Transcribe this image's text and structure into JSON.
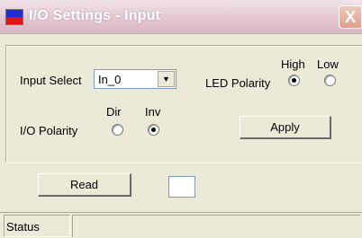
{
  "window": {
    "title": "I/O Settings - Input",
    "close_glyph": "X",
    "icon": "app-icon"
  },
  "input_select": {
    "label": "Input Select",
    "value": "In_0",
    "arrow_glyph": "▼"
  },
  "led_polarity": {
    "label": "LED Polarity",
    "options": [
      {
        "label": "High",
        "selected": true
      },
      {
        "label": "Low",
        "selected": false
      }
    ]
  },
  "io_polarity": {
    "label": "I/O Polarity",
    "options": [
      {
        "label": "Dir",
        "selected": false
      },
      {
        "label": "Inv",
        "selected": true
      }
    ]
  },
  "buttons": {
    "apply": "Apply",
    "read": "Read"
  },
  "read_value": "",
  "statusbar": {
    "label": "Status",
    "text": ""
  }
}
